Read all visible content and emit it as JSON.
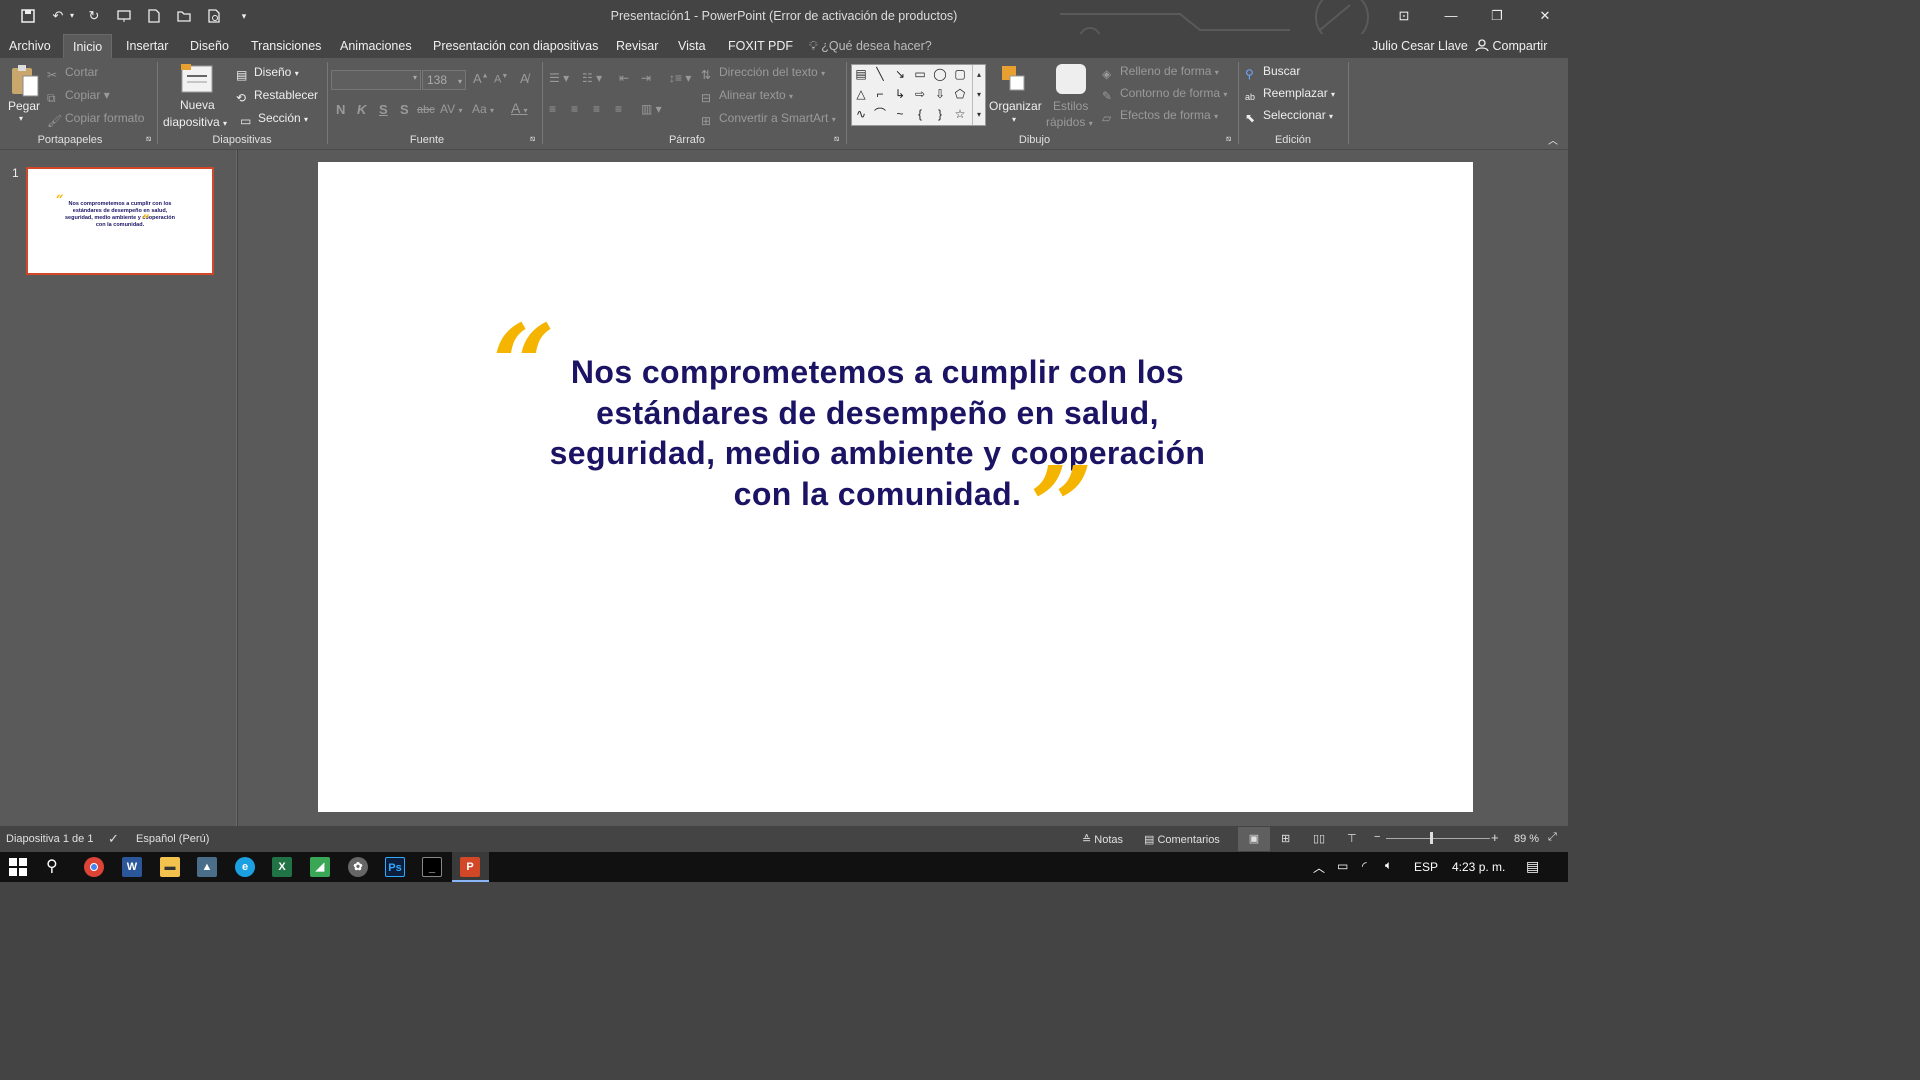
{
  "window": {
    "title": "Presentación1 - PowerPoint (Error de activación de productos)"
  },
  "menu": {
    "tabs": [
      "Archivo",
      "Inicio",
      "Insertar",
      "Diseño",
      "Transiciones",
      "Animaciones",
      "Presentación con diapositivas",
      "Revisar",
      "Vista",
      "FOXIT PDF"
    ],
    "active_tab": "Inicio",
    "tell_me": "¿Qué desea hacer?",
    "user": "Julio Cesar Llave",
    "share": "Compartir"
  },
  "ribbon": {
    "clipboard": {
      "paste": "Pegar",
      "cut": "Cortar",
      "copy": "Copiar",
      "format_painter": "Copiar formato",
      "label": "Portapapeles"
    },
    "slides": {
      "new_slide_1": "Nueva",
      "new_slide_2": "diapositiva",
      "layout": "Diseño",
      "reset": "Restablecer",
      "section": "Sección",
      "label": "Diapositivas"
    },
    "font": {
      "size": "138",
      "bold": "N",
      "italic": "K",
      "underline": "S",
      "shadow": "S",
      "strike": "abc",
      "spacing": "AV",
      "case": "Aa",
      "color": "A",
      "label": "Fuente"
    },
    "paragraph": {
      "text_direction": "Dirección del texto",
      "align_text": "Alinear texto",
      "smartart": "Convertir a SmartArt",
      "label": "Párrafo"
    },
    "drawing": {
      "arrange": "Organizar",
      "quick_styles_1": "Estilos",
      "quick_styles_2": "rápidos",
      "fill": "Relleno de forma",
      "outline": "Contorno de forma",
      "effects": "Efectos de forma",
      "label": "Dibujo"
    },
    "editing": {
      "find": "Buscar",
      "replace": "Reemplazar",
      "select": "Seleccionar",
      "label": "Edición"
    }
  },
  "thumbnail": {
    "number": "1"
  },
  "slide": {
    "open_quote": "“",
    "close_quote": "”",
    "quote": "Nos comprometemos a cumplir con los estándares de desempeño en salud, seguridad, medio ambiente y cooperación con la comunidad.",
    "quote_color": "#1b1464",
    "quote_mark_color": "#f5b400"
  },
  "status": {
    "slide_count": "Diapositiva 1 de 1",
    "language": "Español (Perú)",
    "notes": "Notas",
    "comments": "Comentarios",
    "zoom": "89 %"
  },
  "taskbar": {
    "lang": "ESP",
    "time": "4:23 p. m."
  },
  "colors": {
    "accent": "#d24726",
    "ribbon_bg": "#5a5a5a",
    "title_bg": "#444444"
  }
}
